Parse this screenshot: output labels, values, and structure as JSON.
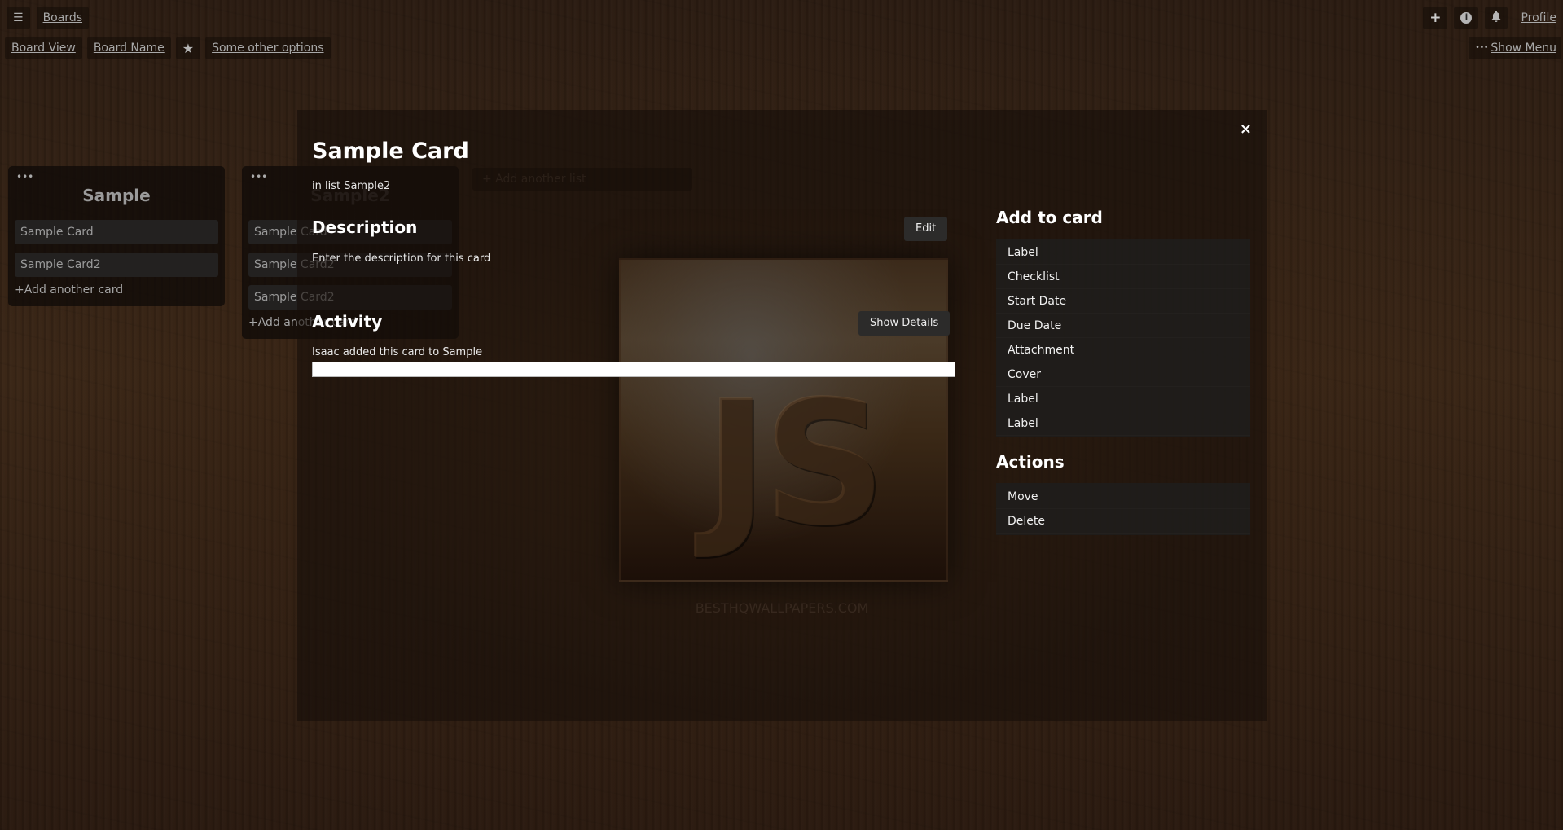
{
  "topbar": {
    "menu_icon": "☰",
    "boards_label": "Boards",
    "add_icon": "+",
    "info_icon": "ℹ",
    "bell_icon": "🔔",
    "profile_label": "Profile"
  },
  "subbar": {
    "board_view_label": "Board View",
    "board_name_label": "Board Name",
    "star_icon": "★",
    "other_options_label": "Some other options",
    "show_menu_dots": "•••",
    "show_menu_label": "Show Menu"
  },
  "lists": [
    {
      "menu_dots": "•••",
      "title": "Sample",
      "cards": [
        "Sample Card",
        "Sample Card2"
      ],
      "add_card_label": "+Add another card"
    },
    {
      "menu_dots": "•••",
      "title": "Sample2",
      "cards": [
        "Sample Card",
        "Sample Card2",
        "Sample Card2"
      ],
      "add_card_label": "+Add another card"
    }
  ],
  "add_list_label": "+ Add another list",
  "background": {
    "logo_text": "JS",
    "watermark": "BESTHQWALLPAPERS.COM"
  },
  "modal": {
    "close_icon": "×",
    "title": "Sample Card",
    "in_list": "in list Sample2",
    "description_heading": "Description",
    "edit_label": "Edit",
    "description_text": "Enter the description for this card",
    "activity_heading": "Activity",
    "show_details_label": "Show Details",
    "activity_entry": "Isaac added this card to Sample",
    "activity_input_value": "",
    "add_to_card_heading": "Add to card",
    "add_to_card_items": [
      "Label",
      "Checklist",
      "Start Date",
      "Due Date",
      "Attachment",
      "Cover",
      "Label",
      "Label"
    ],
    "actions_heading": "Actions",
    "action_items": [
      "Move",
      "Delete"
    ]
  }
}
